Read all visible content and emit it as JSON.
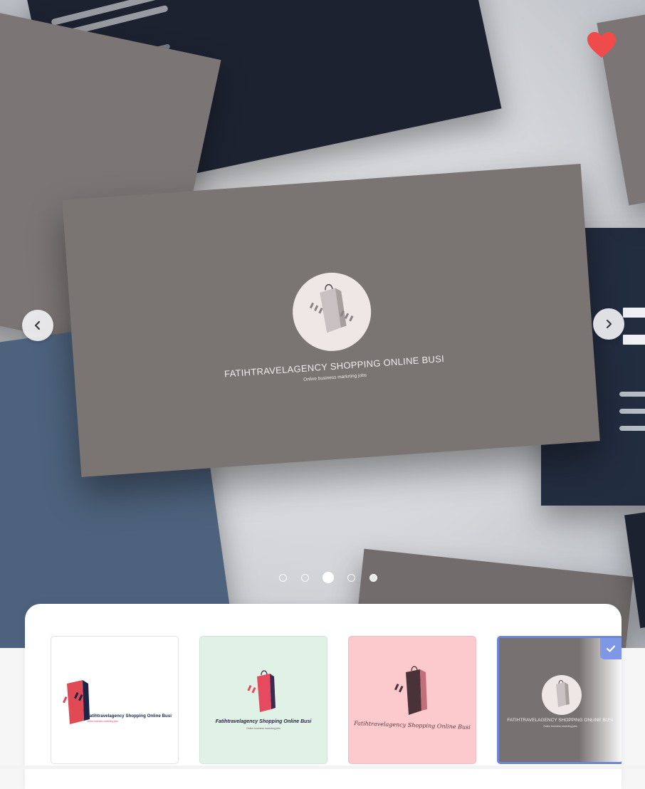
{
  "hero": {
    "main_card": {
      "title": "FATIHTRAVELAGENCY  SHOPPING  ONLINE BUSI",
      "subtitle": "Online business markrting jobs"
    },
    "prev_icon": "chevron-left-icon",
    "next_icon": "chevron-right-icon",
    "favorite_icon": "heart-icon",
    "favorite_color": "#ef4b4b",
    "carousel": {
      "slide_count": 5,
      "active_index": 2
    }
  },
  "thumbnails": [
    {
      "title": "Fatihtravelagency  Shopping  Online Busi",
      "subtitle": "Online business markrting jobs",
      "background": "#ffffff",
      "selected": false
    },
    {
      "title": "Fatihtravelagency  Shopping  Online Busi",
      "subtitle": "Online business markrting jobs",
      "background": "#e0f2e5",
      "selected": false
    },
    {
      "title": "Fatihtravelagency  Shopping  Online Busi",
      "subtitle": "",
      "background": "#fcc9cc",
      "selected": false
    },
    {
      "title": "FATIHTRAVELAGENCY  SHOPPING  ONLINE BUSI",
      "subtitle": "Online business markrting jobs",
      "background": "#777171",
      "selected": true
    }
  ],
  "colors": {
    "accent_selected": "#6f86d8",
    "check_badge": "#7f98e6"
  }
}
